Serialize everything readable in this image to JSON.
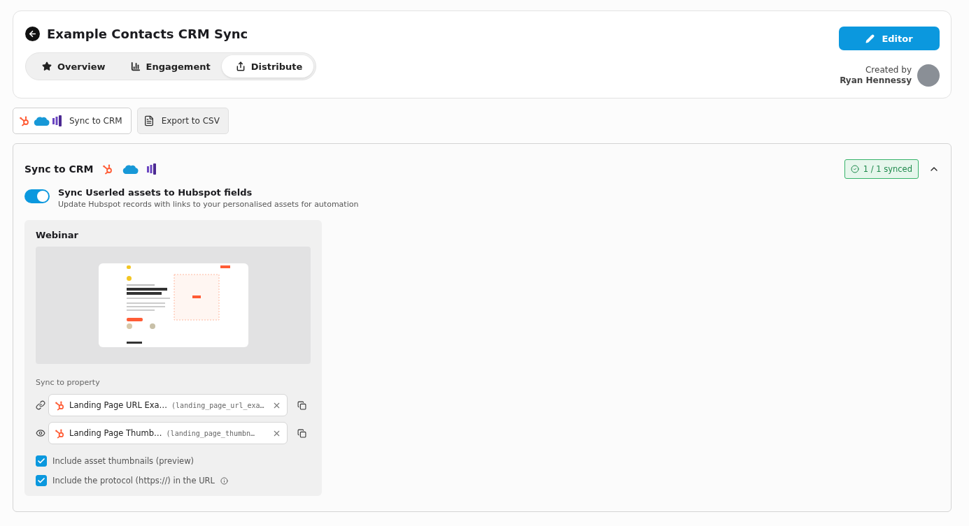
{
  "header": {
    "title": "Example Contacts CRM Sync",
    "editor_button": "Editor",
    "created_by_label": "Created by",
    "author": "Ryan Hennessy",
    "tabs": [
      {
        "label": "Overview",
        "kind": "star",
        "selected": false
      },
      {
        "label": "Engagement",
        "kind": "chart",
        "selected": false
      },
      {
        "label": "Distribute",
        "kind": "share",
        "selected": true
      }
    ]
  },
  "actions": [
    {
      "label": "Sync to CRM",
      "kind": "crm",
      "selected": true
    },
    {
      "label": "Export to CSV",
      "kind": "csv",
      "selected": false
    }
  ],
  "sync_panel": {
    "title": "Sync to CRM",
    "status": "1 / 1 synced",
    "expanded": true,
    "toggle": {
      "label": "Sync Userled assets to Hubspot fields",
      "description": "Update Hubspot records with links to your personalised assets for automation",
      "on": true
    },
    "asset": {
      "title": "Webinar",
      "property_label": "Sync to property",
      "properties": [
        {
          "kind": "link",
          "name": "Landing Page URL Exa…",
          "key": "(landing_page_url_exa…"
        },
        {
          "kind": "preview",
          "name": "Landing Page Thumb…",
          "key": "(landing_page_thumbn…"
        }
      ],
      "options": [
        {
          "label": "Include asset thumbnails (preview)",
          "checked": true,
          "info": false
        },
        {
          "label": "Include the protocol (https://) in the URL",
          "checked": true,
          "info": true
        }
      ]
    }
  }
}
